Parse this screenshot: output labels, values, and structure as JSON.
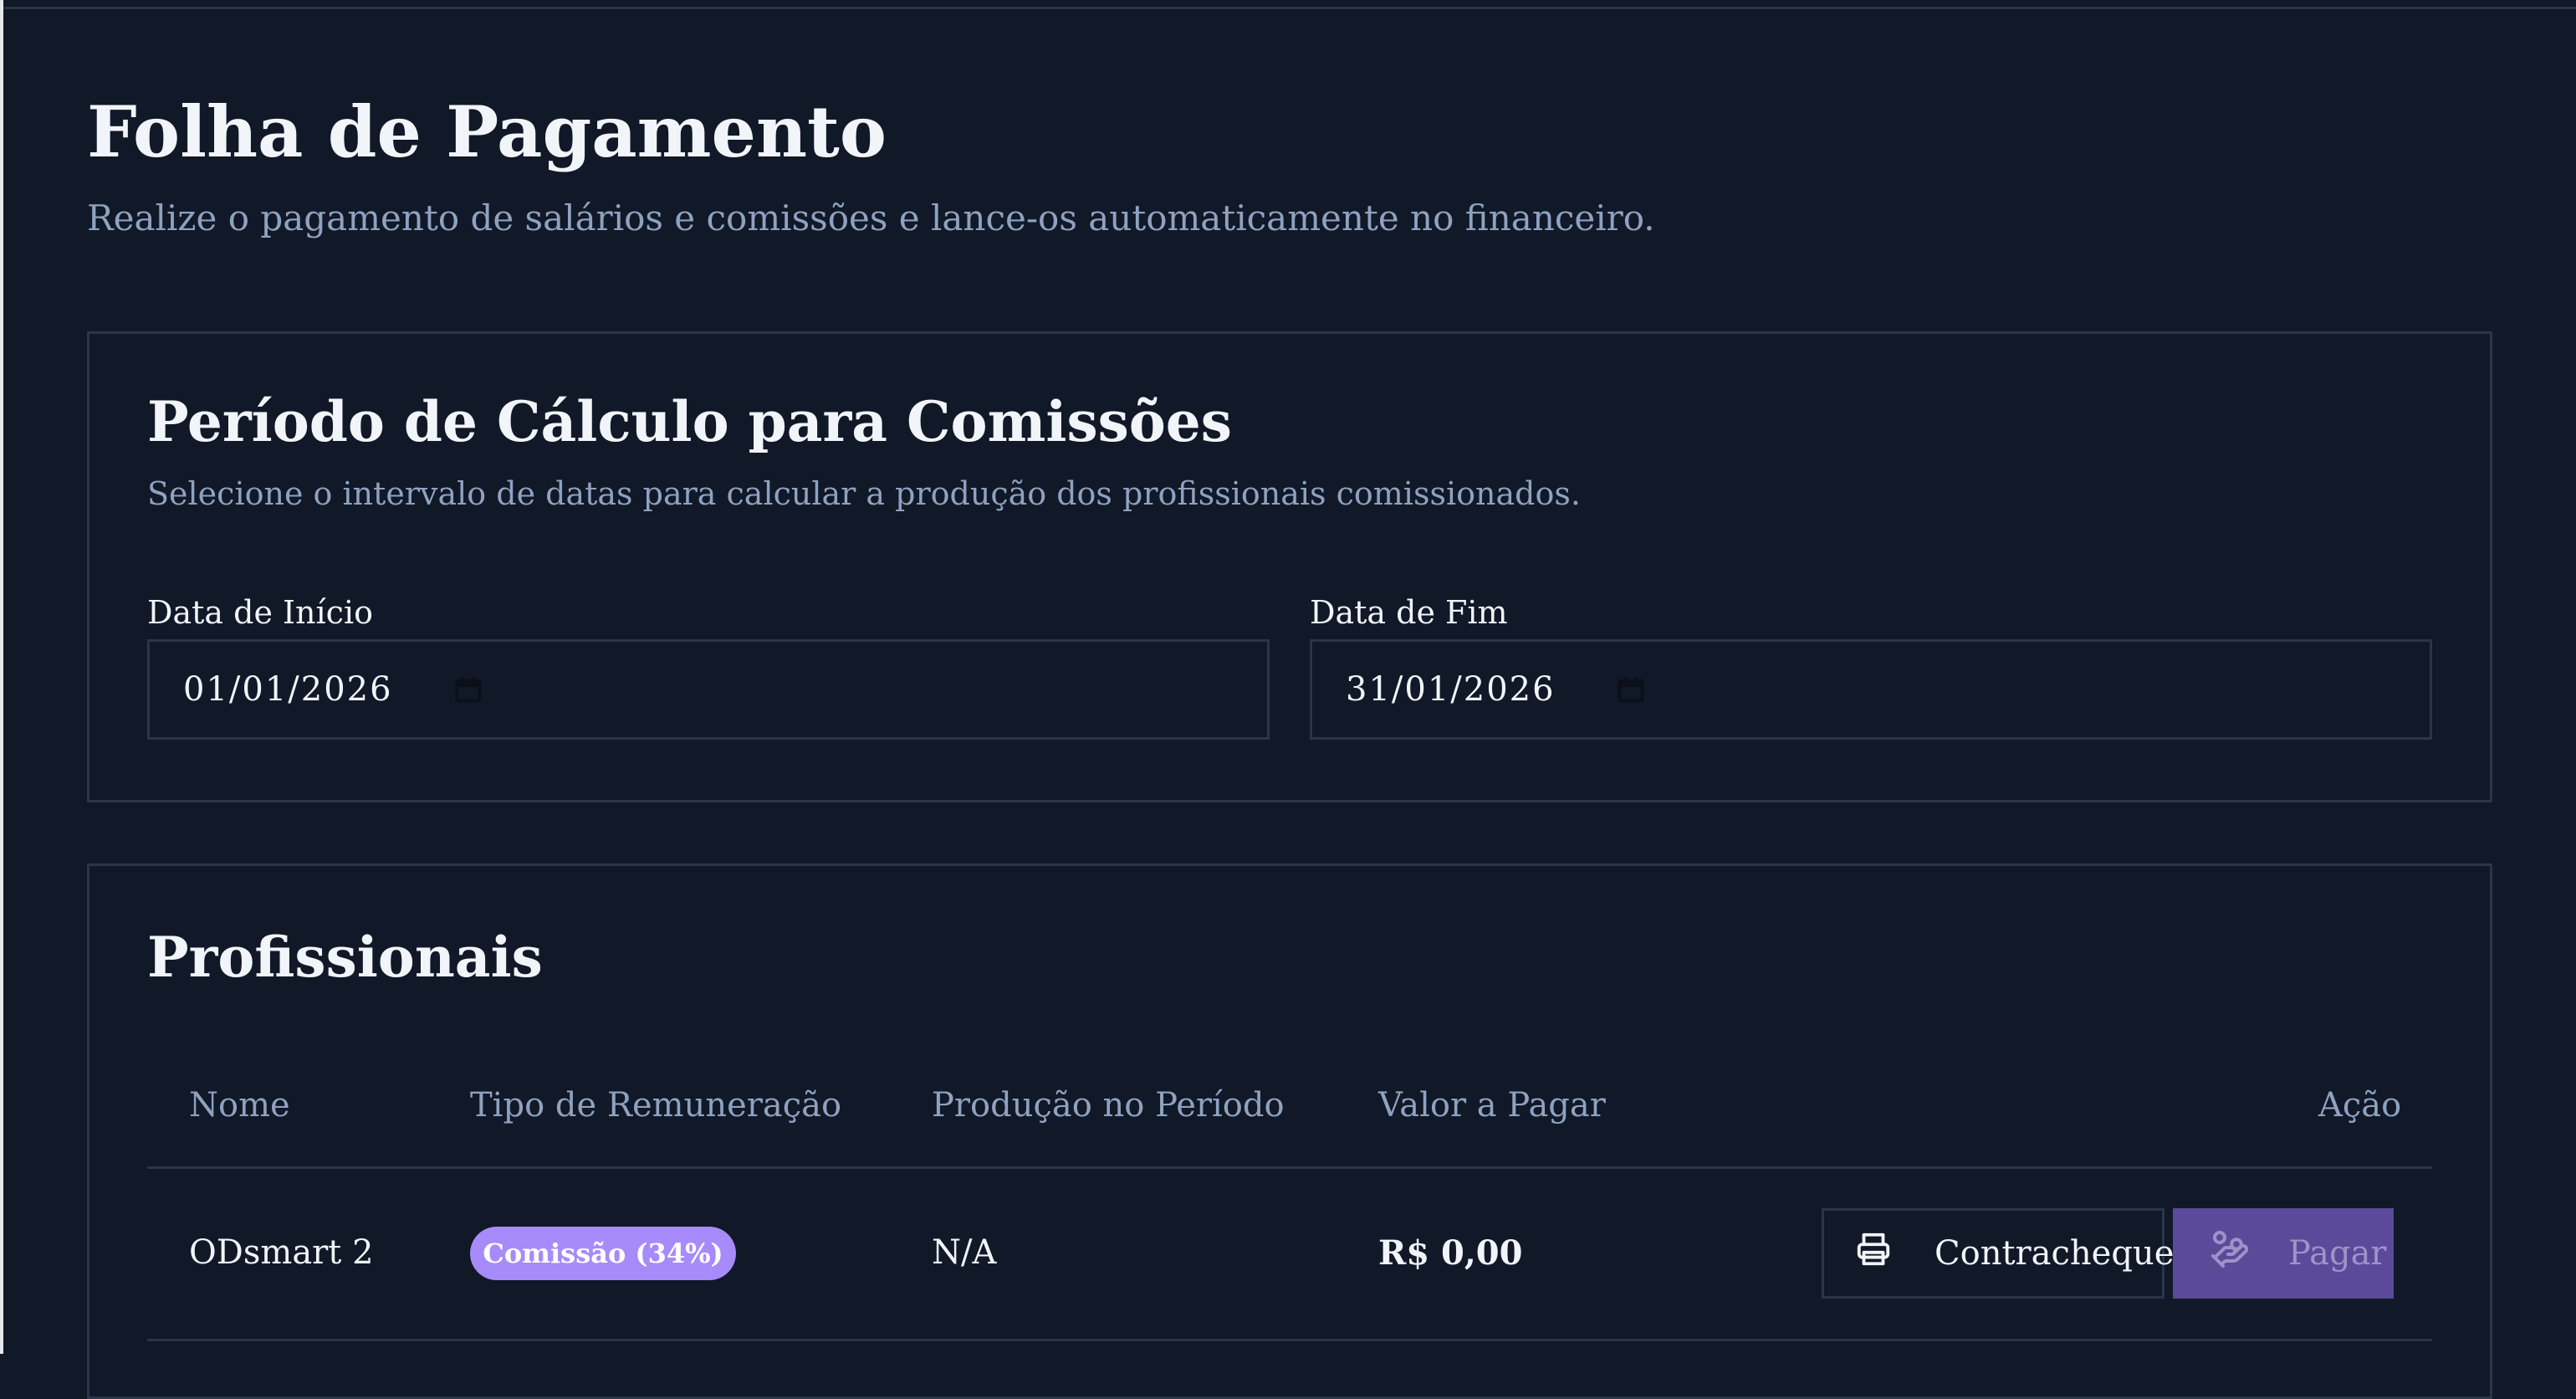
{
  "header": {
    "title": "Folha de Pagamento",
    "subtitle": "Realize o pagamento de salários e comissões e lance-os automaticamente no financeiro."
  },
  "period": {
    "title": "Período de Cálculo para Comissões",
    "description": "Selecione o intervalo de datas para calcular a produção dos profissionais comissionados.",
    "start": {
      "label": "Data de Início",
      "value": "01/01/2026",
      "icon": "calendar-icon"
    },
    "end": {
      "label": "Data de Fim",
      "value": "31/01/2026",
      "icon": "calendar-icon"
    }
  },
  "professionals": {
    "title": "Profissionais",
    "columns": [
      "Nome",
      "Tipo de Remuneração",
      "Produção no Período",
      "Valor a Pagar",
      "Ação"
    ],
    "rows": [
      {
        "name": "ODsmart 2",
        "type": "Comissão (34%)",
        "production": "N/A",
        "amount": "R$ 0,00",
        "payslip_label": "Contracheque",
        "payslip_icon": "printer-icon",
        "pay_label": "Pagar",
        "pay_icon": "hand-coins-icon"
      }
    ]
  },
  "colors": {
    "background": "#111827",
    "border": "#2b3547",
    "muted_text": "#8ea2c0",
    "badge": "#a78bfa",
    "pay_button": "#5b4a99"
  }
}
